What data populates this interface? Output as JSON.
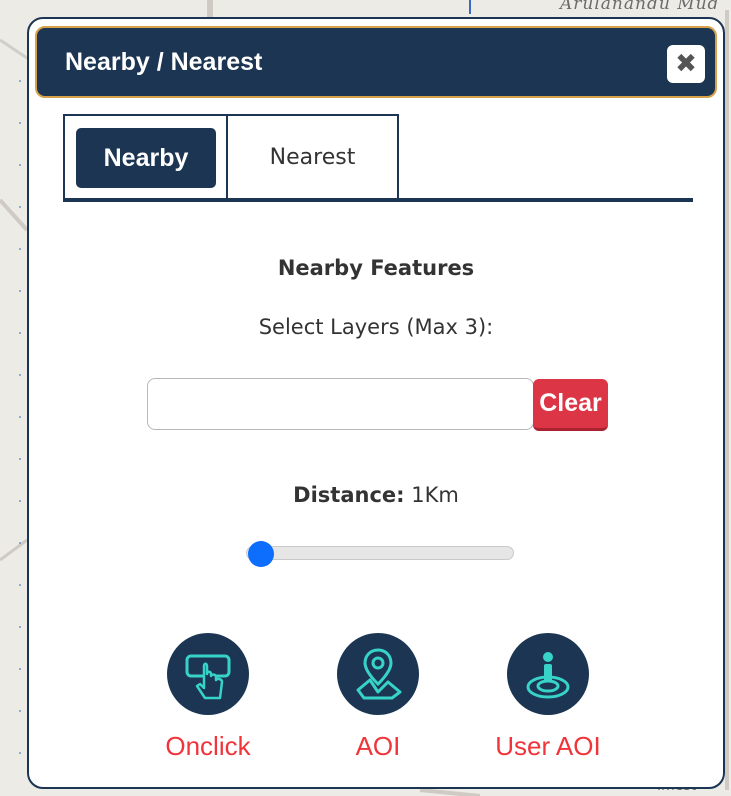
{
  "map": {
    "top_label": "Arulanandu Mud",
    "bottom_label": "Imest"
  },
  "dialog": {
    "title": "Nearby / Nearest",
    "close_icon": "close-icon"
  },
  "tabs": [
    {
      "label": "Nearby",
      "active": true
    },
    {
      "label": "Nearest",
      "active": false
    }
  ],
  "content": {
    "heading": "Nearby Features",
    "subheading": "Select Layers (Max 3):",
    "layer_input": {
      "value": "",
      "placeholder": ""
    },
    "clear_label": "Clear",
    "distance_label": "Distance:",
    "distance_value": "1Km",
    "slider_value_fraction": 0.0
  },
  "actions": [
    {
      "label": "Onclick",
      "icon": "tap-pointer-icon"
    },
    {
      "label": "AOI",
      "icon": "map-pin-area-icon"
    },
    {
      "label": "User AOI",
      "icon": "user-location-icon"
    }
  ],
  "colors": {
    "primary": "#1b3553",
    "title_border": "#d7a24a",
    "danger": "#dc3545",
    "action_label": "#f0343a",
    "slider_thumb": "#0d6efd",
    "icon_accent": "#37d3c8"
  }
}
